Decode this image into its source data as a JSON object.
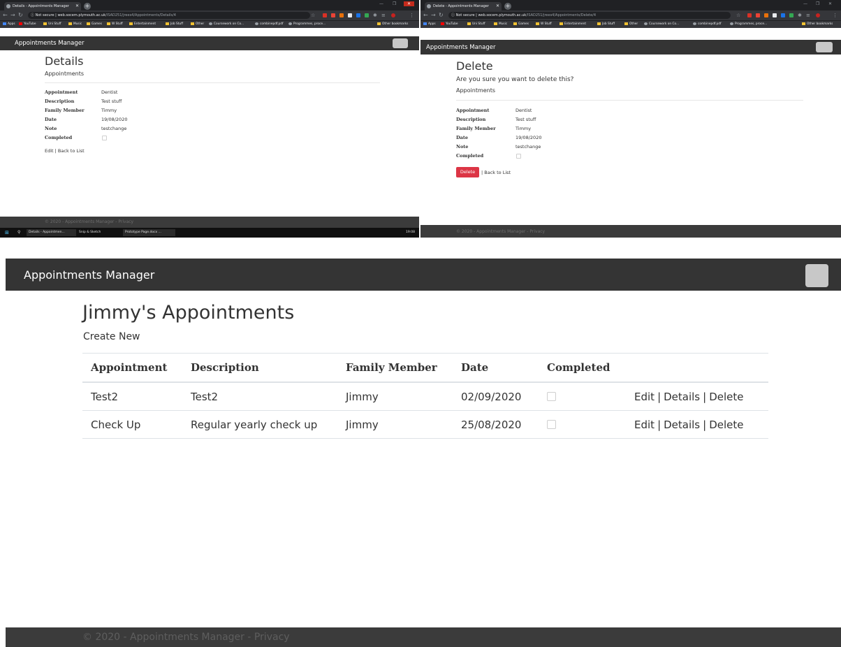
{
  "left_browser": {
    "tab_title": "Details - Appointments Manager",
    "url_secure_label": "Not secure",
    "url_host": "web.socem.plymouth.ac.uk",
    "url_path": "/ISAD251/jrees4/Appointments/Details/4",
    "bookmarks": [
      "Apps",
      "YouTube",
      "Uni Stuff",
      "Music",
      "Games",
      "W Stuff",
      "Entertainment",
      "Job Stuff",
      "Other",
      "Coursework on Co...",
      "combinepdf.pdf",
      "Programmes, proce...",
      "Other bookmarks"
    ],
    "brand": "Appointments Manager",
    "heading": "Details",
    "subheading": "Appointments",
    "fields": [
      {
        "label": "Appointment",
        "value": "Dentist"
      },
      {
        "label": "Description",
        "value": "Test stuff"
      },
      {
        "label": "Family Member",
        "value": "Timmy"
      },
      {
        "label": "Date",
        "value": "19/08/2020"
      },
      {
        "label": "Note",
        "value": "testchange"
      },
      {
        "label": "Completed",
        "value": ""
      }
    ],
    "edit_link": "Edit",
    "back_link": "Back to List",
    "footer": "© 2020 - Appointments Manager - Privacy",
    "taskbar_items": [
      "Details - Appointmen...",
      "Snip & Sketch",
      "Prototype Page.docx ..."
    ],
    "taskbar_time": "19:08"
  },
  "right_browser": {
    "tab_title": "Delete - Appointments Manager",
    "url_secure_label": "Not secure",
    "url_host": "web.socem.plymouth.ac.uk",
    "url_path": "/ISAD251/jrees4/Appointments/Delete/4",
    "bookmarks": [
      "Apps",
      "YouTube",
      "Uni Stuff",
      "Music",
      "Games",
      "W Stuff",
      "Entertainment",
      "Job Stuff",
      "Other",
      "Coursework on Co...",
      "combinepdf.pdf",
      "Programmes, proce...",
      "Other bookmarks"
    ],
    "brand": "Appointments Manager",
    "heading": "Delete",
    "confirm_text": "Are you sure you want to delete this?",
    "subheading": "Appointments",
    "fields": [
      {
        "label": "Appointment",
        "value": "Dentist"
      },
      {
        "label": "Description",
        "value": "Test stuff"
      },
      {
        "label": "Family Member",
        "value": "Timmy"
      },
      {
        "label": "Date",
        "value": "19/08/2020"
      },
      {
        "label": "Note",
        "value": "testchange"
      },
      {
        "label": "Completed",
        "value": ""
      }
    ],
    "delete_button": "Delete",
    "back_link": "Back to List",
    "footer": "© 2020 - Appointments Manager - Privacy"
  },
  "main": {
    "brand": "Appointments Manager",
    "title": "Jimmy's Appointments",
    "create_new": "Create New",
    "columns": [
      "Appointment",
      "Description",
      "Family Member",
      "Date",
      "Completed"
    ],
    "rows": [
      {
        "appointment": "Test2",
        "description": "Test2",
        "family_member": "Jimmy",
        "date": "02/09/2020",
        "completed": false
      },
      {
        "appointment": "Check Up",
        "description": "Regular yearly check up",
        "family_member": "Jimmy",
        "date": "25/08/2020",
        "completed": false
      }
    ],
    "row_actions": {
      "edit": "Edit",
      "details": "Details",
      "delete": "Delete"
    },
    "footer": "© 2020 - Appointments Manager - Privacy"
  },
  "colors": {
    "navbar": "#343434",
    "footer": "#3b3b3b",
    "delete_button": "#dc3545",
    "browser_chrome": "#35363a"
  }
}
